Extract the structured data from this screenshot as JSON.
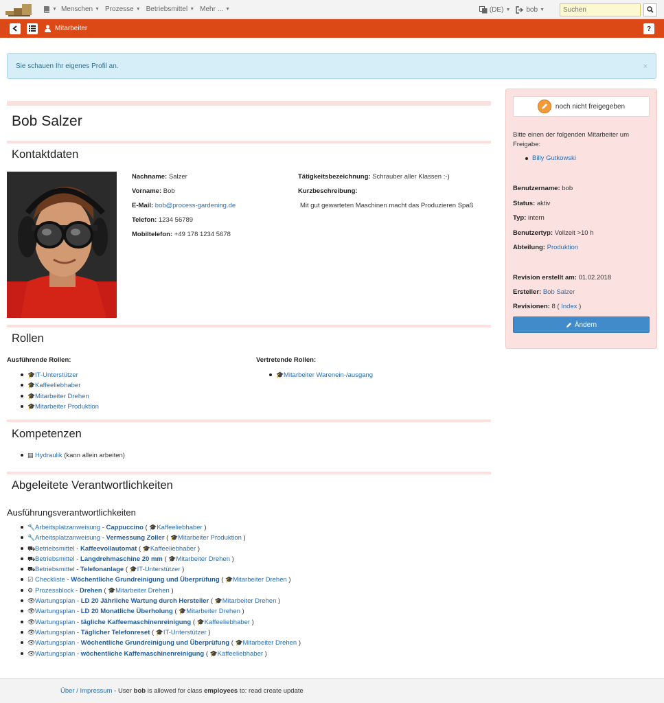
{
  "nav": {
    "menu": [
      {
        "label": "Menschen"
      },
      {
        "label": "Prozesse"
      },
      {
        "label": "Betriebsmittel"
      },
      {
        "label": "Mehr ..."
      }
    ],
    "language": "(DE)",
    "user": "bob",
    "search_placeholder": "Suchen"
  },
  "subbar": {
    "title": "Mitarbeiter"
  },
  "alert": {
    "text": "Sie schauen Ihr eigenes Profil an.",
    "close": "×"
  },
  "profile": {
    "name": "Bob Salzer",
    "contact_heading": "Kontaktdaten",
    "fields": {
      "lastname_label": "Nachname:",
      "lastname": "Salzer",
      "firstname_label": "Vorname:",
      "firstname": "Bob",
      "email_label": "E-Mail:",
      "email": "bob@process-gardening.de",
      "phone_label": "Telefon:",
      "phone": "1234 56789",
      "mobile_label": "Mobiltelefon:",
      "mobile": "+49 178 1234 5678",
      "job_label": "Tätigkeitsbezeichnung:",
      "job": "Schrauber aller Klassen :-)",
      "desc_label": "Kurzbeschreibung:",
      "desc": "Mit gut gewarteten Maschinen macht das Produzieren Spaß"
    }
  },
  "roles": {
    "heading": "Rollen",
    "exec_label": "Ausführende Rollen:",
    "exec": [
      "IT-Unterstützer",
      "Kaffeeliebhaber",
      "Mitarbeiter Drehen",
      "Mitarbeiter Produktion"
    ],
    "deputy_label": "Vertretende Rollen:",
    "deputy": [
      "Mitarbeiter Warenein-/ausgang"
    ]
  },
  "competences": {
    "heading": "Kompetenzen",
    "items": [
      {
        "name": "Hydraulik",
        "note": "(kann allein arbeiten)"
      }
    ]
  },
  "responsibilities": {
    "heading": "Abgeleitete Verantwortlichkeiten",
    "subheading": "Ausführungsverantwortlichkeiten",
    "items": [
      {
        "icon": "wrench-icon",
        "glyph": "🔧",
        "type": "Arbeitsplatzanweisung",
        "name": "Cappuccino",
        "role": "Kaffeeliebhaber"
      },
      {
        "icon": "wrench-icon",
        "glyph": "🔧",
        "type": "Arbeitsplatzanweisung",
        "name": "Vermessung Zoller",
        "role": "Mitarbeiter Produktion"
      },
      {
        "icon": "truck-icon",
        "glyph": "⛟",
        "type": "Betriebsmittel",
        "name": "Kaffeevollautomat",
        "role": "Kaffeeliebhaber"
      },
      {
        "icon": "truck-icon",
        "glyph": "⛟",
        "type": "Betriebsmittel",
        "name": "Langdrehmaschine 20 mm",
        "role": "Mitarbeiter Drehen"
      },
      {
        "icon": "truck-icon",
        "glyph": "⛟",
        "type": "Betriebsmittel",
        "name": "Telefonanlage",
        "role": "IT-Unterstützer"
      },
      {
        "icon": "checkbox-icon",
        "glyph": "☑",
        "type": "Checkliste",
        "name": "Wöchentliche Grundreinigung und Überprüfung",
        "role": "Mitarbeiter Drehen"
      },
      {
        "icon": "gear-icon",
        "glyph": "⚙",
        "type": "Prozessblock",
        "name": "Drehen",
        "role": "Mitarbeiter Drehen"
      },
      {
        "icon": "eye-icon",
        "glyph": "👁",
        "type": "Wartungsplan",
        "name": "LD 20 Jährliche Wartung durch Hersteller",
        "role": "Mitarbeiter Drehen"
      },
      {
        "icon": "eye-icon",
        "glyph": "👁",
        "type": "Wartungsplan",
        "name": "LD 20 Monatliche Überholung",
        "role": "Mitarbeiter Drehen"
      },
      {
        "icon": "eye-icon",
        "glyph": "👁",
        "type": "Wartungsplan",
        "name": "tägliche Kaffeemaschinenreinigung",
        "role": "Kaffeeliebhaber"
      },
      {
        "icon": "eye-icon",
        "glyph": "👁",
        "type": "Wartungsplan",
        "name": "Täglicher Telefonreset",
        "role": "IT-Unterstützer"
      },
      {
        "icon": "eye-icon",
        "glyph": "👁",
        "type": "Wartungsplan",
        "name": "Wöchentliche Grundreinigung und Überprüfung",
        "role": "Mitarbeiter Drehen"
      },
      {
        "icon": "eye-icon",
        "glyph": "👁",
        "type": "Wartungsplan",
        "name": "wöchentliche Kaffemaschinenreinigung",
        "role": "Kaffeeliebhaber"
      }
    ]
  },
  "sidebar": {
    "status": "noch nicht freigegeben",
    "request_text_1": "Bitte einen der folgenden Mitarbeiter um",
    "request_text_2": "Freigabe:",
    "approver": "Billy Gutkowski",
    "username_label": "Benutzername:",
    "username": "bob",
    "status_label": "Status:",
    "status_value": "aktiv",
    "type_label": "Typ:",
    "type": "intern",
    "usertype_label": "Benutzertyp:",
    "usertype": "Vollzeit >10 h",
    "department_label": "Abteilung:",
    "department": "Produktion",
    "revision_label": "Revision erstellt am:",
    "revision": "01.02.2018",
    "creator_label": "Ersteller:",
    "creator": "Bob Salzer",
    "revisions_label": "Revisionen:",
    "revisions": "8",
    "index_link": "Index",
    "edit_button": "Ändern"
  },
  "footer": {
    "link": "Über / Impressum",
    "text_1": " - User ",
    "user": "bob",
    "text_2": " is allowed for class ",
    "class": "employees",
    "text_3": " to: read create update"
  },
  "colors": {
    "accent": "#dc4916",
    "link": "#2a6db0",
    "primary_button": "#428bca",
    "sidebar_bg": "#fbe1df",
    "alert_bg": "#d6eef7"
  }
}
